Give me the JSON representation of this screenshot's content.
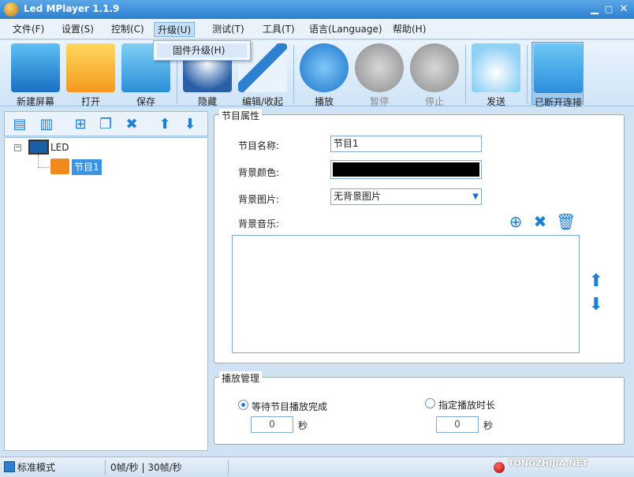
{
  "window": {
    "title": "Led MPlayer 1.1.9"
  },
  "menu": {
    "items": [
      "文件(F)",
      "设置(S)",
      "控制(C)",
      "升级(U)",
      "测试(T)",
      "工具(T)",
      "语言(Language)",
      "帮助(H)"
    ],
    "dropdown_item": "固件升级(H)"
  },
  "toolbar": {
    "new_screen": "新建屏幕",
    "open": "打开",
    "save": "保存",
    "hide": "隐藏",
    "edit": "编辑/收起",
    "play": "播放",
    "pause": "暂停",
    "stop": "停止",
    "send": "发送",
    "connection": "已断开连接"
  },
  "tree": {
    "root": "LED",
    "program": "节目1"
  },
  "program_props": {
    "title": "节目属性",
    "name_label": "节目名称:",
    "name_value": "节目1",
    "bg_color_label": "背景颜色:",
    "bg_color_value": "#000000",
    "bg_image_label": "背景图片:",
    "bg_image_value": "无背景图片",
    "bg_music_label": "背景音乐:"
  },
  "play_mgmt": {
    "title": "播放管理",
    "wait_label": "等待节目播放完成",
    "wait_value": "0",
    "duration_label": "指定播放时长",
    "duration_value": "0",
    "unit": "秒"
  },
  "status": {
    "mode": "标准模式",
    "fps": "0帧/秒 | 30帧/秒",
    "watermark": "TONGZHIJIA.NET"
  }
}
